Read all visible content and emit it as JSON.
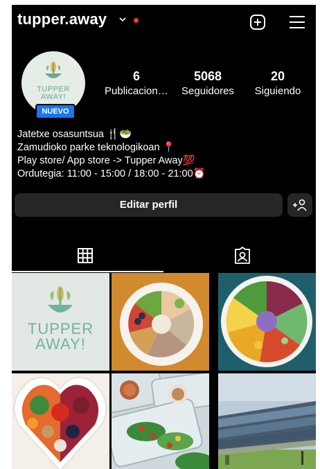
{
  "header": {
    "username": "tupper.away"
  },
  "profile": {
    "badge": "NUEVO",
    "logo_line1": "TUPPER",
    "logo_line2": "AWAY!",
    "stats": [
      {
        "value": "6",
        "label": "Publicaciones"
      },
      {
        "value": "5068",
        "label": "Seguidores"
      },
      {
        "value": "20",
        "label": "Siguiendo"
      }
    ],
    "bio": [
      "Jatetxe osasuntsua 🍴🥗",
      "Zamudioko parke teknologikoan 📍",
      "Play store/ App store -> Tupper Away💯",
      "Ordutegia: 11:00 - 15:00 / 18:00 - 21:00⏰"
    ]
  },
  "actions": {
    "edit_profile": "Editar perfil"
  },
  "grid": {
    "post1_line1": "TUPPER",
    "post1_line2": "AWAY!"
  },
  "colors": {
    "background": "#000000",
    "button": "#262626",
    "badge": "#1877f2",
    "notification": "#ff3040",
    "brand_green": "#6fb59b"
  }
}
